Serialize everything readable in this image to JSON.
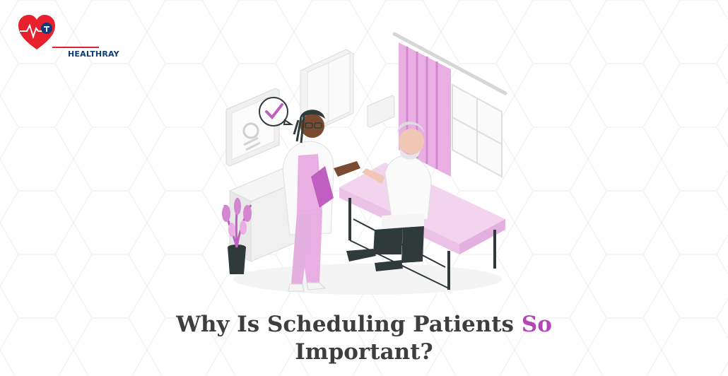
{
  "brand": {
    "name": "HEALTHRAY",
    "logo_icon": "heart-pulse-icon",
    "colors": {
      "heart": "#e6202c",
      "navy": "#0e3d7a"
    }
  },
  "illustration": {
    "scene": "doctor-consultation-illustration",
    "colors": {
      "accent": "#e9aee2",
      "accent_dark": "#c15ec1",
      "skin": "#7a4a31",
      "dark": "#2f3a3b"
    }
  },
  "headline": {
    "line1_prefix": "Why Is Scheduling Patients ",
    "line1_accent": "So",
    "line2": "Important?"
  }
}
